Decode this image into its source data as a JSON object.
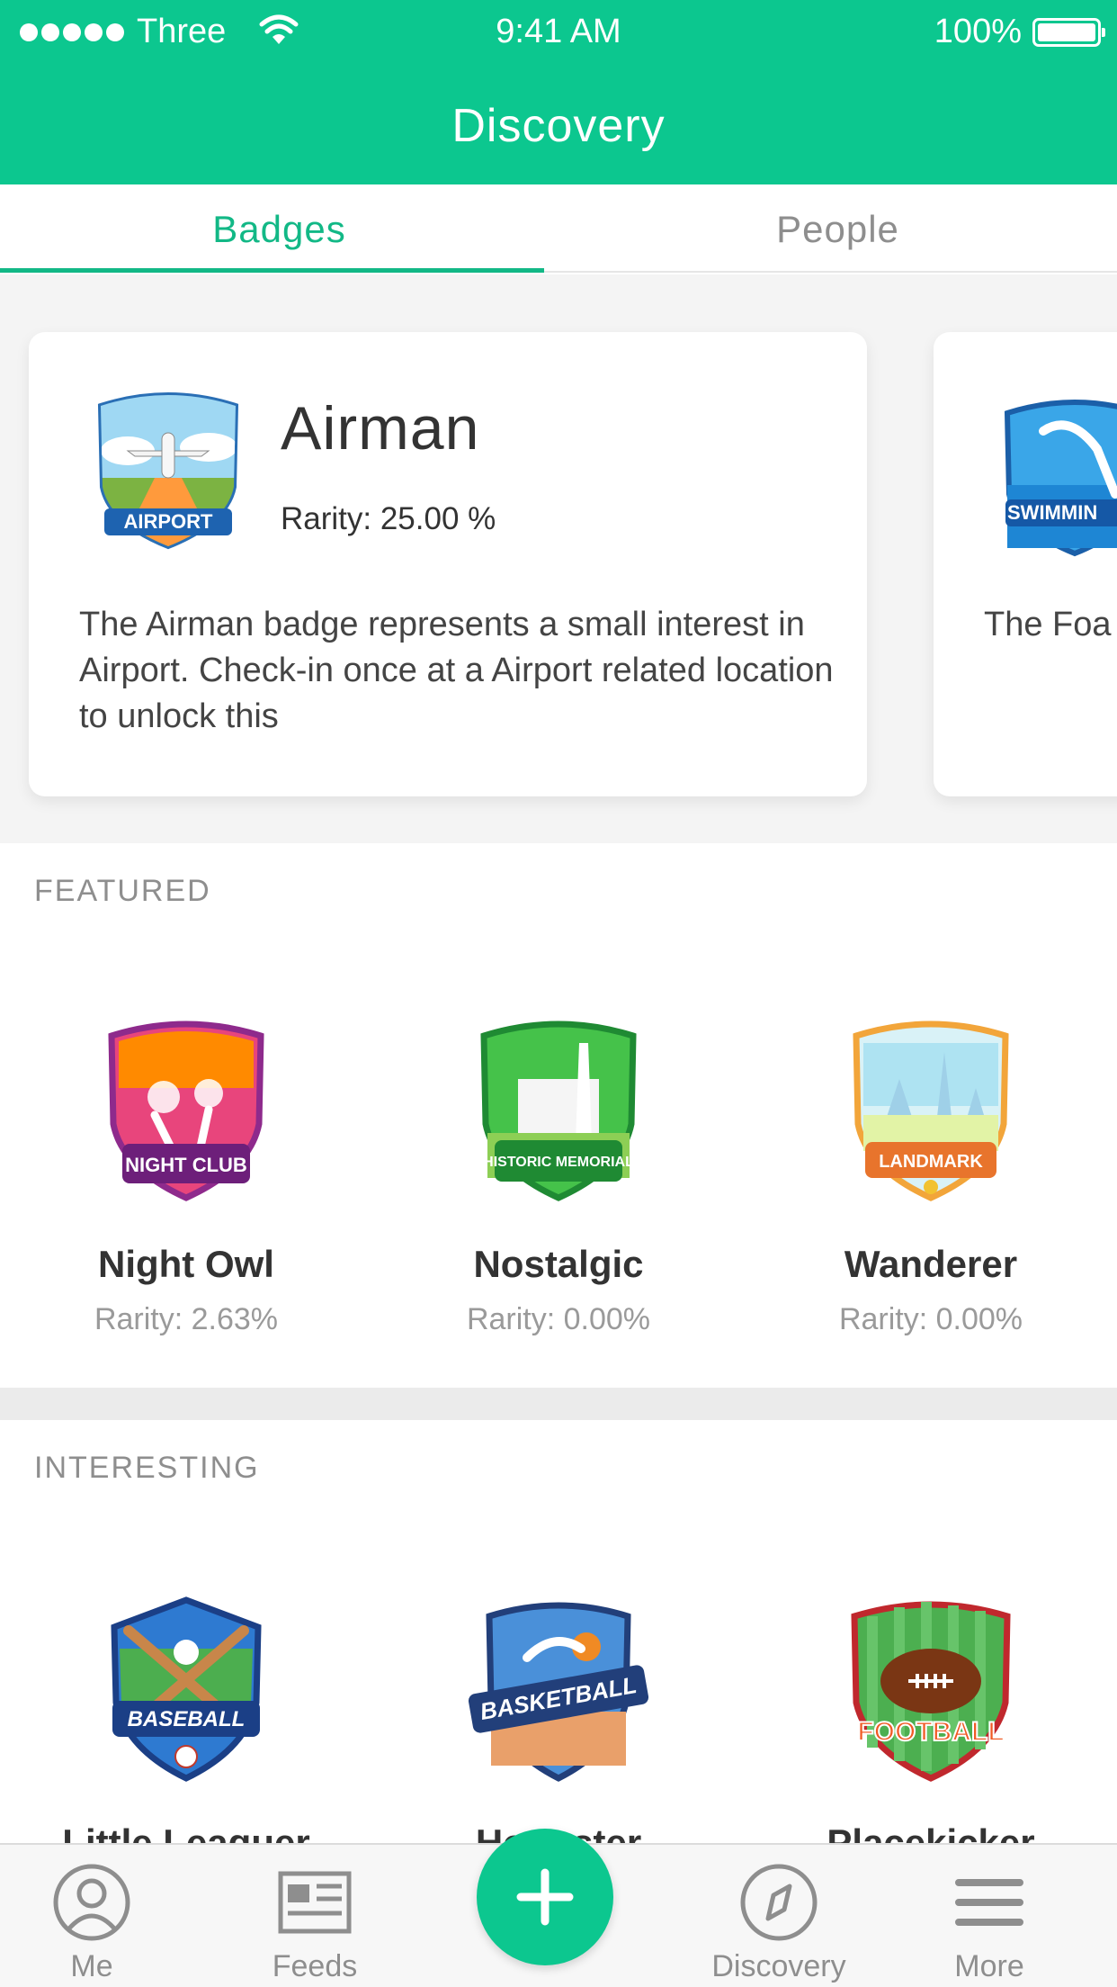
{
  "status_bar": {
    "carrier": "Three",
    "time": "9:41 AM",
    "battery": "100%"
  },
  "header": {
    "title": "Discovery"
  },
  "tabs": [
    {
      "label": "Badges",
      "active": true
    },
    {
      "label": "People",
      "active": false
    }
  ],
  "carousel": {
    "cards": [
      {
        "name": "Airman",
        "rarity": "Rarity: 25.00 %",
        "description": "The Airman badge represents a small interest in Airport. Check-in once at a Airport related location to unlock this",
        "badge_label": "AIRPORT"
      },
      {
        "badge_label": "SWIMMIN",
        "description": "The Foa small in once at"
      }
    ]
  },
  "featured": {
    "title": "FEATURED",
    "items": [
      {
        "name": "Night Owl",
        "rarity": "Rarity: 2.63%",
        "badge_label": "NIGHT CLUB",
        "icon": "night-club-badge-icon"
      },
      {
        "name": "Nostalgic",
        "rarity": "Rarity: 0.00%",
        "badge_label": "HISTORIC MEMORIAL",
        "icon": "historic-memorial-badge-icon"
      },
      {
        "name": "Wanderer",
        "rarity": "Rarity: 0.00%",
        "badge_label": "LANDMARK",
        "icon": "landmark-badge-icon"
      }
    ]
  },
  "interesting": {
    "title": "INTERESTING",
    "items": [
      {
        "name": "Little Leaguer",
        "badge_label": "BASEBALL",
        "icon": "baseball-badge-icon"
      },
      {
        "name": "Hoopster",
        "badge_label": "BASKETBALL",
        "icon": "basketball-badge-icon"
      },
      {
        "name": "Placekicker",
        "badge_label": "FOOTBALL",
        "icon": "football-badge-icon"
      }
    ]
  },
  "bottom_nav": {
    "items": [
      {
        "label": "Me",
        "icon": "profile-icon"
      },
      {
        "label": "Feeds",
        "icon": "feeds-icon"
      },
      {
        "label": "",
        "icon": "plus-icon"
      },
      {
        "label": "Discovery",
        "icon": "compass-icon"
      },
      {
        "label": "More",
        "icon": "menu-icon"
      }
    ]
  },
  "colors": {
    "brand": "#0cc78f",
    "tab_active": "#12b886",
    "muted": "#8e8e8e"
  }
}
